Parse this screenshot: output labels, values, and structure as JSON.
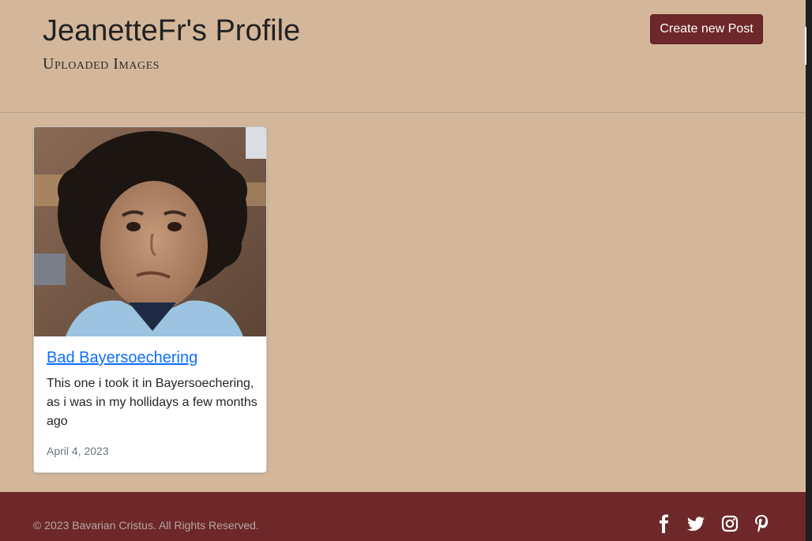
{
  "header": {
    "title": "JeanetteFr's Profile",
    "subtitle": "Uploaded Images",
    "create_button_label": "Create new Post"
  },
  "posts": [
    {
      "title": "Bad Bayersoechering",
      "description": "This one i took it in Bayersoechering, as i was in my hollidays a few months ago",
      "date": "April 4, 2023",
      "image_icon": "photo-of-child-with-curly-hair"
    }
  ],
  "footer": {
    "copyright": "© 2023 Bavarian Cristus. All Rights Reserved.",
    "social_icons": [
      "facebook-icon",
      "twitter-icon",
      "instagram-icon",
      "pinterest-icon"
    ]
  },
  "colors": {
    "background": "#d4b79a",
    "accent": "#6e2829",
    "link": "#0d6efd"
  }
}
